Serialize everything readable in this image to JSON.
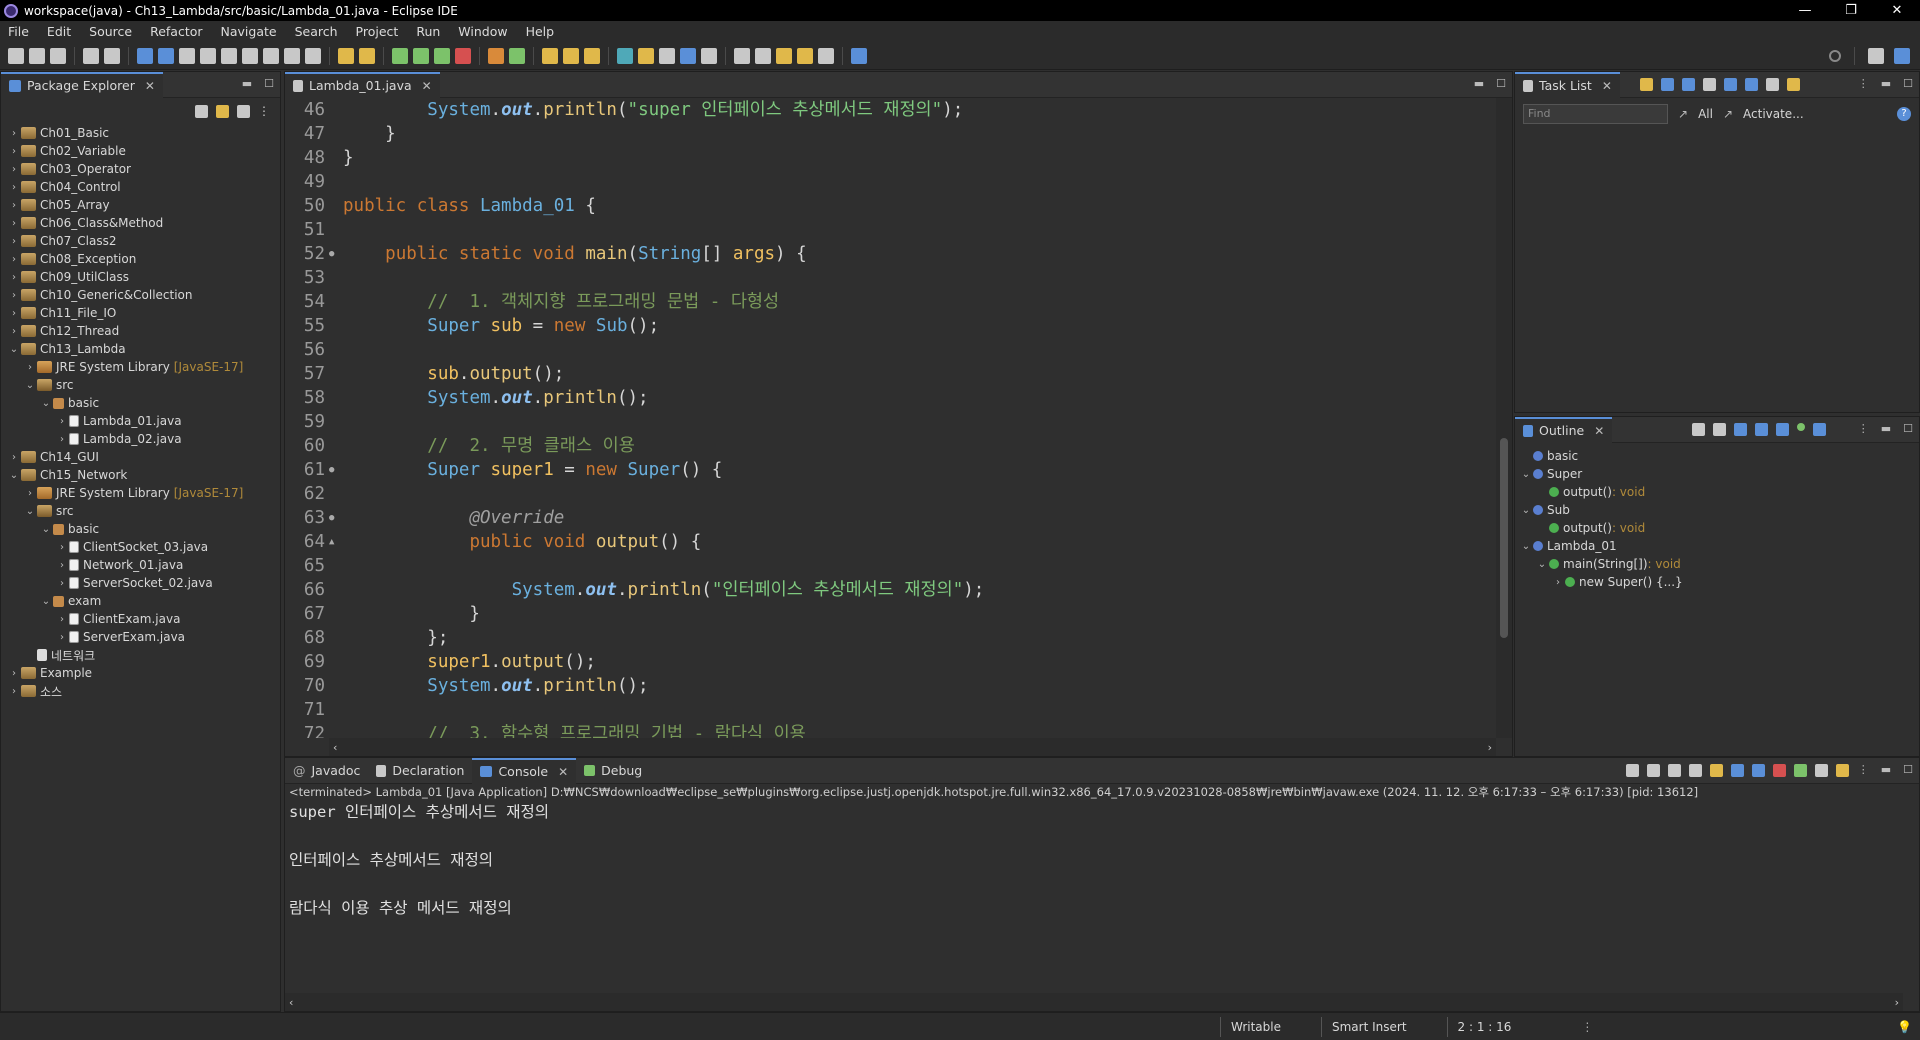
{
  "window": {
    "title": "workspace(java) - Ch13_Lambda/src/basic/Lambda_01.java - Eclipse IDE",
    "minimize": "—",
    "restore": "❐",
    "close": "✕"
  },
  "menu": [
    "File",
    "Edit",
    "Source",
    "Refactor",
    "Navigate",
    "Search",
    "Project",
    "Run",
    "Window",
    "Help"
  ],
  "package_explorer": {
    "title": "Package Explorer",
    "items": [
      {
        "indent": 0,
        "arrow": "›",
        "icon": "proj",
        "label": "Ch01_Basic",
        "extra": ""
      },
      {
        "indent": 0,
        "arrow": "›",
        "icon": "proj",
        "label": "Ch02_Variable",
        "extra": ""
      },
      {
        "indent": 0,
        "arrow": "›",
        "icon": "proj",
        "label": "Ch03_Operator",
        "extra": ""
      },
      {
        "indent": 0,
        "arrow": "›",
        "icon": "proj",
        "label": "Ch04_Control",
        "extra": ""
      },
      {
        "indent": 0,
        "arrow": "›",
        "icon": "proj",
        "label": "Ch05_Array",
        "extra": ""
      },
      {
        "indent": 0,
        "arrow": "›",
        "icon": "proj",
        "label": "Ch06_Class&Method",
        "extra": ""
      },
      {
        "indent": 0,
        "arrow": "›",
        "icon": "proj",
        "label": "Ch07_Class2",
        "extra": ""
      },
      {
        "indent": 0,
        "arrow": "›",
        "icon": "proj",
        "label": "Ch08_Exception",
        "extra": ""
      },
      {
        "indent": 0,
        "arrow": "›",
        "icon": "proj",
        "label": "Ch09_UtilClass",
        "extra": ""
      },
      {
        "indent": 0,
        "arrow": "›",
        "icon": "proj",
        "label": "Ch10_Generic&Collection",
        "extra": ""
      },
      {
        "indent": 0,
        "arrow": "›",
        "icon": "proj",
        "label": "Ch11_File_IO",
        "extra": ""
      },
      {
        "indent": 0,
        "arrow": "›",
        "icon": "proj",
        "label": "Ch12_Thread",
        "extra": ""
      },
      {
        "indent": 0,
        "arrow": "⌄",
        "icon": "proj",
        "label": "Ch13_Lambda",
        "extra": ""
      },
      {
        "indent": 1,
        "arrow": "›",
        "icon": "lib",
        "label": "JRE System Library",
        "extra": "[JavaSE-17]"
      },
      {
        "indent": 1,
        "arrow": "⌄",
        "icon": "src",
        "label": "src",
        "extra": ""
      },
      {
        "indent": 2,
        "arrow": "⌄",
        "icon": "pkgi",
        "label": "basic",
        "extra": ""
      },
      {
        "indent": 3,
        "arrow": "›",
        "icon": "java",
        "label": "Lambda_01.java",
        "extra": ""
      },
      {
        "indent": 3,
        "arrow": "›",
        "icon": "java",
        "label": "Lambda_02.java",
        "extra": ""
      },
      {
        "indent": 0,
        "arrow": "›",
        "icon": "proj",
        "label": "Ch14_GUI",
        "extra": ""
      },
      {
        "indent": 0,
        "arrow": "⌄",
        "icon": "proj",
        "label": "Ch15_Network",
        "extra": ""
      },
      {
        "indent": 1,
        "arrow": "›",
        "icon": "lib",
        "label": "JRE System Library",
        "extra": "[JavaSE-17]"
      },
      {
        "indent": 1,
        "arrow": "⌄",
        "icon": "src",
        "label": "src",
        "extra": ""
      },
      {
        "indent": 2,
        "arrow": "⌄",
        "icon": "pkgi",
        "label": "basic",
        "extra": ""
      },
      {
        "indent": 3,
        "arrow": "›",
        "icon": "java",
        "label": "ClientSocket_03.java",
        "extra": ""
      },
      {
        "indent": 3,
        "arrow": "›",
        "icon": "java",
        "label": "Network_01.java",
        "extra": ""
      },
      {
        "indent": 3,
        "arrow": "›",
        "icon": "java",
        "label": "ServerSocket_02.java",
        "extra": ""
      },
      {
        "indent": 2,
        "arrow": "⌄",
        "icon": "pkgi",
        "label": "exam",
        "extra": ""
      },
      {
        "indent": 3,
        "arrow": "›",
        "icon": "java",
        "label": "ClientExam.java",
        "extra": ""
      },
      {
        "indent": 3,
        "arrow": "›",
        "icon": "java",
        "label": "ServerExam.java",
        "extra": ""
      },
      {
        "indent": 1,
        "arrow": "",
        "icon": "file",
        "label": "네트워크",
        "extra": ""
      },
      {
        "indent": 0,
        "arrow": "›",
        "icon": "proj",
        "label": "Example",
        "extra": ""
      },
      {
        "indent": 0,
        "arrow": "›",
        "icon": "proj",
        "label": "소스",
        "extra": ""
      }
    ]
  },
  "editor": {
    "tab": "Lambda_01.java",
    "lines": [
      {
        "n": "46",
        "m": "",
        "html": "        <span class='type'>System</span>.<span class='fld'>out</span>.<span class='meth'>println</span>(<span class='str'>\"super 인터페이스 추상메서드 재정의\"</span>);"
      },
      {
        "n": "47",
        "m": "",
        "html": "    }"
      },
      {
        "n": "48",
        "m": "",
        "html": "}"
      },
      {
        "n": "49",
        "m": "",
        "html": ""
      },
      {
        "n": "50",
        "m": "",
        "html": "<span class='kw'>public class</span> <span class='type'>Lambda_01</span> {"
      },
      {
        "n": "51",
        "m": "",
        "html": ""
      },
      {
        "n": "52",
        "m": "●",
        "html": "    <span class='kw'>public static void</span> <span class='meth'>main</span>(<span class='type'>String</span>[] <span class='var'>args</span>) {"
      },
      {
        "n": "53",
        "m": "",
        "html": ""
      },
      {
        "n": "54",
        "m": "",
        "html": "        <span class='cm'>//  1. 객체지향 프로그래밍 문법 - 다형성</span>"
      },
      {
        "n": "55",
        "m": "",
        "html": "        <span class='type'>Super</span> <span class='var'>sub</span> = <span class='kw'>new</span> <span class='type'>Sub</span>();"
      },
      {
        "n": "56",
        "m": "",
        "html": ""
      },
      {
        "n": "57",
        "m": "",
        "html": "        <span class='var'>sub</span>.<span class='meth'>output</span>();"
      },
      {
        "n": "58",
        "m": "",
        "html": "        <span class='type'>System</span>.<span class='fld'>out</span>.<span class='meth'>println</span>();"
      },
      {
        "n": "59",
        "m": "",
        "html": ""
      },
      {
        "n": "60",
        "m": "",
        "html": "        <span class='cm'>//  2. 무명 클래스 이용</span>"
      },
      {
        "n": "61",
        "m": "●",
        "html": "        <span class='type'>Super</span> <span class='var'>super1</span> = <span class='kw'>new</span> <span class='type'>Super</span>() {"
      },
      {
        "n": "62",
        "m": "",
        "html": ""
      },
      {
        "n": "63",
        "m": "●",
        "html": "            <span class='ann'>@Override</span>"
      },
      {
        "n": "64",
        "m": "▲",
        "html": "            <span class='kw'>public void</span> <span class='meth'>output</span>() {"
      },
      {
        "n": "65",
        "m": "",
        "html": ""
      },
      {
        "n": "66",
        "m": "",
        "html": "                <span class='type'>System</span>.<span class='fld'>out</span>.<span class='meth'>println</span>(<span class='str'>\"인터페이스 추상메서드 재정의\"</span>);"
      },
      {
        "n": "67",
        "m": "",
        "html": "            }"
      },
      {
        "n": "68",
        "m": "",
        "html": "        };"
      },
      {
        "n": "69",
        "m": "",
        "html": "        <span class='var'>super1</span>.<span class='meth'>output</span>();"
      },
      {
        "n": "70",
        "m": "",
        "html": "        <span class='type'>System</span>.<span class='fld'>out</span>.<span class='meth'>println</span>();"
      },
      {
        "n": "71",
        "m": "",
        "html": ""
      },
      {
        "n": "72",
        "m": "",
        "html": "        <span class='cm'>//  3. 함수형 프로그래밍 기법 - 람다식 이용</span>"
      }
    ]
  },
  "tasklist": {
    "title": "Task List",
    "find_placeholder": "Find",
    "all": "All",
    "activate": "Activate..."
  },
  "outline": {
    "title": "Outline",
    "items": [
      {
        "indent": 0,
        "arrow": "",
        "label": "basic",
        "type": ""
      },
      {
        "indent": 0,
        "arrow": "⌄",
        "label": "Super",
        "type": ""
      },
      {
        "indent": 1,
        "arrow": "",
        "label": "output()",
        "type": " : void"
      },
      {
        "indent": 0,
        "arrow": "⌄",
        "label": "Sub",
        "type": ""
      },
      {
        "indent": 1,
        "arrow": "",
        "label": "output()",
        "type": " : void"
      },
      {
        "indent": 0,
        "arrow": "⌄",
        "label": "Lambda_01",
        "type": ""
      },
      {
        "indent": 1,
        "arrow": "⌄",
        "label": "main(String[])",
        "type": " : void"
      },
      {
        "indent": 2,
        "arrow": "›",
        "label": "new Super() {...}",
        "type": ""
      }
    ]
  },
  "console": {
    "tabs": [
      "Javadoc",
      "Declaration",
      "Console",
      "Debug"
    ],
    "header": "<terminated> Lambda_01 [Java Application] D:₩NCS₩download₩eclipse_se₩plugins₩org.eclipse.justj.openjdk.hotspot.jre.full.win32.x86_64_17.0.9.v20231028-0858₩jre₩bin₩javaw.exe  (2024. 11. 12. 오후 6:17:33 – 오후 6:17:33) [pid: 13612]",
    "lines": [
      "super 인터페이스 추상메서드 재정의",
      "",
      "인터페이스 추상메서드 재정의",
      "",
      "람다식 이용 추상 메서드 재정의"
    ]
  },
  "status": {
    "writable": "Writable",
    "insert": "Smart Insert",
    "position": "2 : 1 : 16"
  }
}
